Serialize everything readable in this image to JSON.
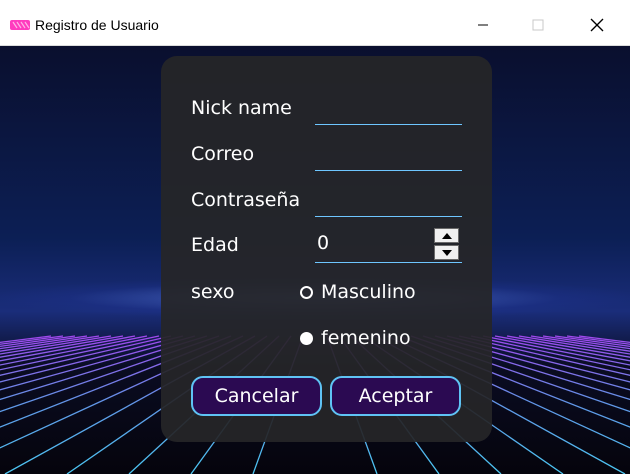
{
  "window": {
    "title": "Registro de Usuario",
    "accent_icon_color": "#ff3cbe"
  },
  "form": {
    "nickname_label": "Nick name",
    "nickname_value": "",
    "email_label": "Correo",
    "email_value": "",
    "password_label": "Contraseña",
    "password_value": "",
    "age_label": "Edad",
    "age_value": "0",
    "sex_label": "sexo",
    "sex_options": [
      {
        "label": "Masculino",
        "selected": false
      },
      {
        "label": "femenino",
        "selected": true
      }
    ],
    "cancel_label": "Cancelar",
    "accept_label": "Aceptar"
  },
  "colors": {
    "panel_bg": "#262628",
    "button_bg": "#2b0a52",
    "button_border": "#5fc3f5",
    "field_underline": "#6ec6ff"
  }
}
